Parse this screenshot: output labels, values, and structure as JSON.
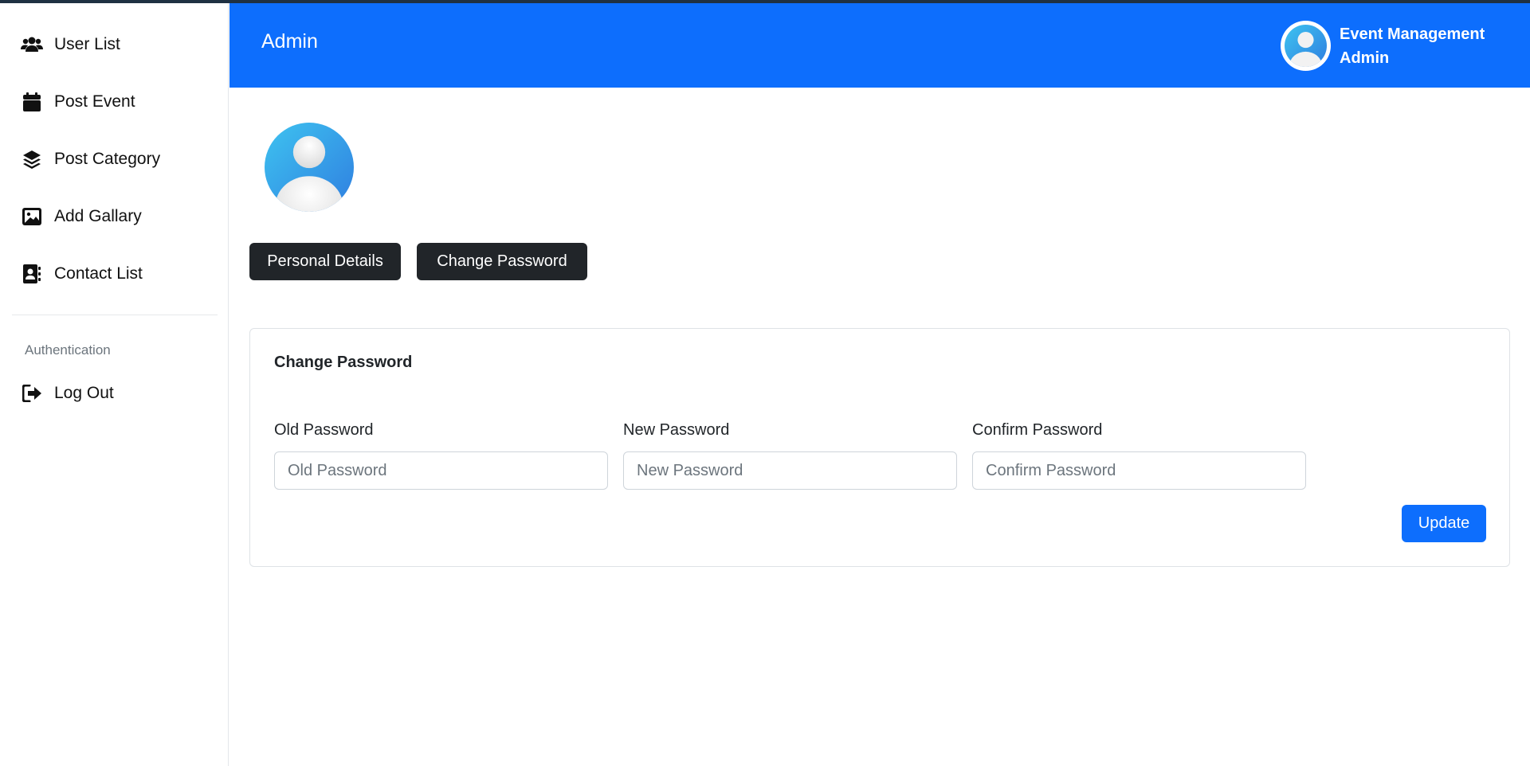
{
  "header": {
    "title": "Admin",
    "user_name": "Event Management",
    "user_role": "Admin"
  },
  "sidebar": {
    "items": [
      {
        "label": "User List",
        "icon": "users-icon"
      },
      {
        "label": "Post Event",
        "icon": "calendar-icon"
      },
      {
        "label": "Post Category",
        "icon": "layers-icon"
      },
      {
        "label": "Add Gallary",
        "icon": "image-icon"
      },
      {
        "label": "Contact List",
        "icon": "address-book-icon"
      }
    ],
    "section_heading": "Authentication",
    "logout": {
      "label": "Log Out",
      "icon": "sign-out-icon"
    }
  },
  "main": {
    "tabs": [
      {
        "label": "Personal Details"
      },
      {
        "label": "Change Password"
      }
    ],
    "card": {
      "title": "Change Password",
      "fields": [
        {
          "label": "Old Password",
          "placeholder": "Old Password",
          "value": ""
        },
        {
          "label": "New Password",
          "placeholder": "New Password",
          "value": ""
        },
        {
          "label": "Confirm Password",
          "placeholder": "Confirm Password",
          "value": ""
        }
      ],
      "submit_label": "Update"
    }
  },
  "colors": {
    "primary": "#0d6efd",
    "dark_button": "#212529",
    "top_strip": "#1f3142"
  }
}
